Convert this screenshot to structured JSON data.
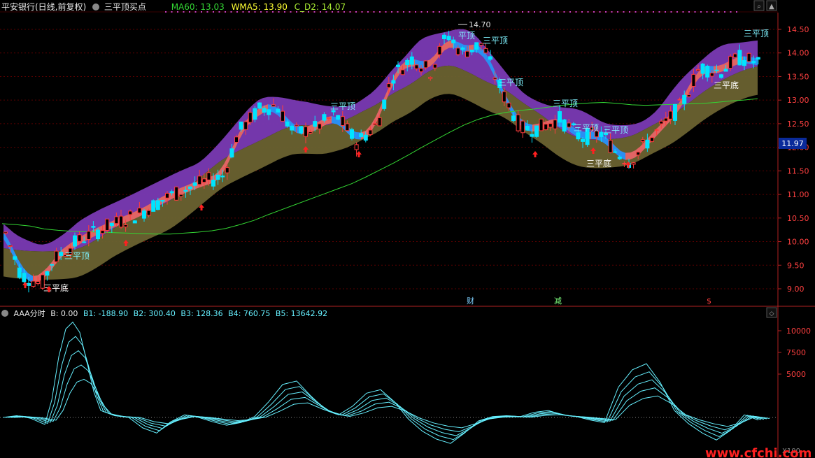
{
  "header": {
    "stock_title": "平安银行(日线,前复权)",
    "indicator_name": "三平顶买点",
    "ma60": "MA60: 13.03",
    "wma5": "WMA5: 13.90",
    "cd2": "C_D2: 14.07"
  },
  "colors": {
    "up": "#ff3c3c",
    "down": "#00e4ff",
    "ma60": "#33d633",
    "band_upper": "#7a3ab4",
    "band_lower": "#6a6230",
    "ribbon_up": "#e06464",
    "ribbon_down": "#2a8ff2",
    "osc": "#66f0ff",
    "label_top": "#7ff3ff",
    "label_bottom": "#ffffff"
  },
  "main_chart": {
    "y_ticks": [
      "14.50",
      "14.00",
      "13.50",
      "13.00",
      "12.50",
      "12.00",
      "11.50",
      "11.00",
      "10.50",
      "10.00",
      "9.50",
      "9.00"
    ],
    "current_price": "11.97",
    "high_marker": "14.70",
    "events": [
      "财",
      "减",
      "$"
    ],
    "labels": {
      "top": "三平顶",
      "bottom": "三平底",
      "top_short": "平顶"
    }
  },
  "sub_chart": {
    "title": "AAA分时",
    "b": "B: 0.00",
    "b1": "B1: -188.90",
    "b2": "B2: 300.40",
    "b3": "B3: 128.36",
    "b4": "B4: 760.75",
    "b5": "B5: 13642.92",
    "y_ticks": [
      "10000",
      "7500",
      "5000"
    ],
    "corner": "X100"
  },
  "watermark": "www.cfchi.com",
  "chart_data": [
    {
      "type": "line",
      "title": "平安银行(日线,前复权)",
      "xlabel": "",
      "ylabel": "",
      "ylim": [
        8.75,
        14.75
      ],
      "grid": true,
      "series": [
        {
          "name": "MA60",
          "x": [
            0,
            20,
            40,
            60,
            80,
            100,
            120,
            140,
            160,
            180,
            200,
            220,
            240,
            260,
            280,
            300,
            320,
            340,
            360,
            380,
            400,
            420,
            440,
            460,
            480,
            500,
            520,
            540,
            560,
            580,
            600,
            620,
            640,
            660,
            680,
            700,
            720,
            740,
            760,
            780,
            800,
            820,
            840,
            860,
            880,
            900,
            920,
            940,
            960,
            980,
            1000,
            1020,
            1040,
            1060,
            1080
          ],
          "values": [
            10.38,
            10.36,
            10.33,
            10.27,
            10.24,
            10.22,
            10.21,
            10.2,
            10.19,
            10.18,
            10.17,
            10.16,
            10.16,
            10.18,
            10.2,
            10.23,
            10.28,
            10.36,
            10.45,
            10.57,
            10.68,
            10.79,
            10.9,
            11.01,
            11.12,
            11.23,
            11.37,
            11.52,
            11.67,
            11.83,
            12.0,
            12.16,
            12.32,
            12.47,
            12.59,
            12.68,
            12.74,
            12.78,
            12.81,
            12.85,
            12.89,
            12.92,
            12.94,
            12.95,
            12.93,
            12.9,
            12.89,
            12.9,
            12.91,
            12.92,
            12.93,
            12.95,
            12.98,
            13.0,
            13.03
          ]
        }
      ]
    },
    {
      "type": "line",
      "title": "AAA分时",
      "xlabel": "",
      "ylabel": "",
      "ylim": [
        -3500,
        12000
      ],
      "grid": false,
      "series": [
        {
          "name": "B5",
          "x": [
            0,
            20,
            40,
            60,
            70,
            80,
            90,
            100,
            110,
            120,
            130,
            140,
            160,
            180,
            200,
            220,
            240,
            260,
            280,
            300,
            320,
            340,
            360,
            380,
            400,
            420,
            440,
            460,
            480,
            500,
            520,
            540,
            560,
            580,
            600,
            620,
            640,
            660,
            680,
            700,
            720,
            740,
            760,
            780,
            800,
            820,
            840,
            860,
            880,
            900,
            920,
            940,
            960,
            980,
            1000,
            1020,
            1040,
            1060,
            1080
          ],
          "values": [
            0,
            200,
            -100,
            -800,
            2000,
            7000,
            10200,
            11000,
            9800,
            6500,
            3000,
            800,
            200,
            0,
            -1200,
            -1800,
            -500,
            300,
            0,
            -500,
            -900,
            -600,
            100,
            1800,
            3800,
            4200,
            2500,
            1000,
            300,
            1300,
            2800,
            3200,
            1800,
            -200,
            -1600,
            -2500,
            -3000,
            -1800,
            -400,
            100,
            200,
            100,
            600,
            800,
            300,
            100,
            -300,
            -600,
            3500,
            5500,
            6200,
            4000,
            800,
            -700,
            -1800,
            -2600,
            -1500,
            300,
            -300
          ]
        }
      ]
    }
  ]
}
